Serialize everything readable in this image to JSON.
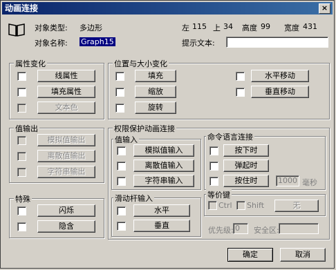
{
  "window": {
    "title": "动画连接",
    "close_symbol": "×"
  },
  "object": {
    "type_label": "对象类型:",
    "type_value": "多边形",
    "name_label": "对象名称:",
    "name_value": "Graph15",
    "left_label": "左",
    "left_value": "115",
    "top_label": "上",
    "top_value": "34",
    "height_label": "高度",
    "height_value": "99",
    "width_label": "宽度",
    "width_value": "431",
    "hint_label": "提示文本:"
  },
  "property_change": {
    "title": "属性变化",
    "buttons": [
      "线属性",
      "填充属性",
      "文本色"
    ]
  },
  "position_size": {
    "title": "位置与大小变化",
    "left_buttons": [
      "填充",
      "缩放",
      "旋转"
    ],
    "right_buttons": [
      "水平移动",
      "垂直移动"
    ]
  },
  "value_output": {
    "title": "值输出",
    "buttons": [
      "模拟值输出",
      "离散值输出",
      "字符串输出"
    ]
  },
  "user_input": {
    "title": "权限保护动画连接",
    "subtitle": "值输入",
    "buttons": [
      "模拟值输入",
      "离散值输入",
      "字符串输入"
    ]
  },
  "slider_input": {
    "title": "滑动杆输入",
    "buttons": [
      "水平",
      "垂直"
    ]
  },
  "command": {
    "title": "命令语言连接",
    "buttons": [
      "按下时",
      "弹起时",
      "按住时"
    ],
    "interval_value": "1000",
    "interval_unit": "毫秒"
  },
  "hotkey": {
    "title": "等价键",
    "ctrl": "Ctrl",
    "shift": "Shift",
    "key_button": "无"
  },
  "special": {
    "title": "特殊",
    "buttons": [
      "闪烁",
      "隐含"
    ]
  },
  "priority": {
    "label": "优先级:",
    "value": "0"
  },
  "security": {
    "label": "安全区:",
    "value": ""
  },
  "footer": {
    "ok": "确定",
    "cancel": "取消"
  }
}
